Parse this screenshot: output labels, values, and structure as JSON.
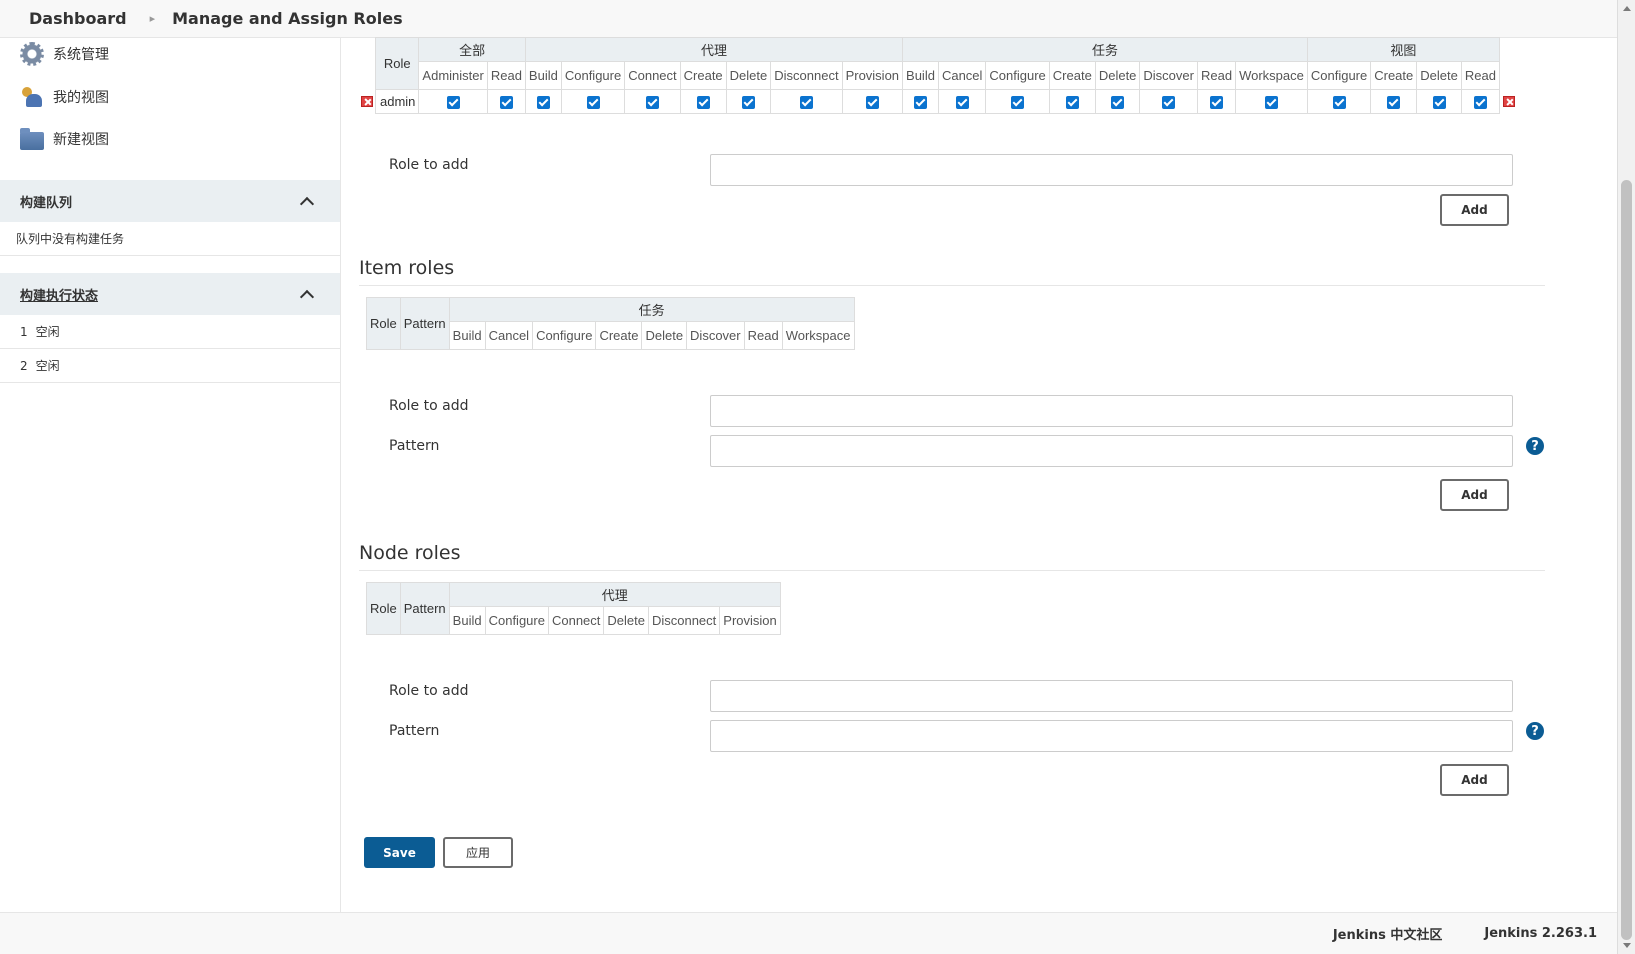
{
  "breadcrumb": {
    "home": "Dashboard",
    "current": "Manage and Assign Roles"
  },
  "sidebar": {
    "tasks": [
      {
        "label": "系统管理",
        "icon": "gear-icon"
      },
      {
        "label": "我的视图",
        "icon": "people-icon"
      },
      {
        "label": "新建视图",
        "icon": "folder-icon"
      }
    ],
    "build_queue": {
      "title": "构建队列",
      "empty": "队列中没有构建任务"
    },
    "executors": {
      "title": "构建执行状态",
      "rows": [
        {
          "num": "1",
          "status": "空闲"
        },
        {
          "num": "2",
          "status": "空闲"
        }
      ]
    }
  },
  "global_roles": {
    "role_header": "Role",
    "groups": [
      {
        "name": "全部",
        "perms": [
          "Administer",
          "Read"
        ]
      },
      {
        "name": "代理",
        "perms": [
          "Build",
          "Configure",
          "Connect",
          "Create",
          "Delete",
          "Disconnect",
          "Provision"
        ]
      },
      {
        "name": "任务",
        "perms": [
          "Build",
          "Cancel",
          "Configure",
          "Create",
          "Delete",
          "Discover",
          "Read",
          "Workspace"
        ]
      },
      {
        "name": "视图",
        "perms": [
          "Configure",
          "Create",
          "Delete",
          "Read"
        ]
      }
    ],
    "rows": [
      {
        "role": "admin",
        "checked": true
      }
    ],
    "role_to_add_label": "Role to add",
    "add_button": "Add"
  },
  "item_roles": {
    "title": "Item roles",
    "role_header": "Role",
    "pattern_header": "Pattern",
    "groups": [
      {
        "name": "任务",
        "perms": [
          "Build",
          "Cancel",
          "Configure",
          "Create",
          "Delete",
          "Discover",
          "Read",
          "Workspace"
        ]
      }
    ],
    "role_to_add_label": "Role to add",
    "pattern_label": "Pattern",
    "add_button": "Add"
  },
  "node_roles": {
    "title": "Node roles",
    "role_header": "Role",
    "pattern_header": "Pattern",
    "groups": [
      {
        "name": "代理",
        "perms": [
          "Build",
          "Configure",
          "Connect",
          "Delete",
          "Disconnect",
          "Provision"
        ]
      }
    ],
    "role_to_add_label": "Role to add",
    "pattern_label": "Pattern",
    "add_button": "Add"
  },
  "actions": {
    "save": "Save",
    "apply": "应用"
  },
  "help_glyph": "?",
  "footer": {
    "community": "Jenkins 中文社区",
    "version": "Jenkins 2.263.1"
  }
}
